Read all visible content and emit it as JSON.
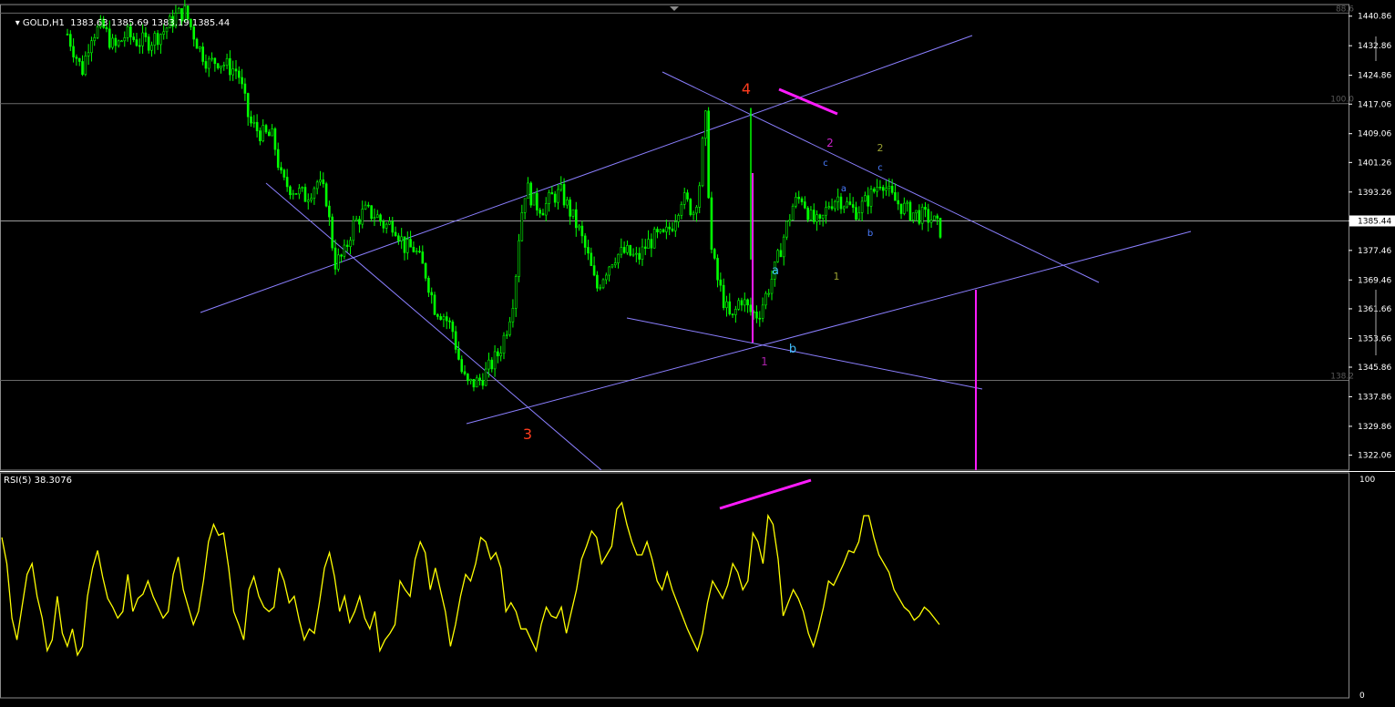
{
  "header": {
    "symbol_info": "GOLD,H1  1383.63 1385.69 1383.19 1385.44",
    "current_price": "1385.44"
  },
  "rsi_header": "RSI(5) 38.3076",
  "chart_data": [
    {
      "type": "candlestick",
      "symbol": "GOLD",
      "timeframe": "H1",
      "ohlc_last": {
        "open": 1383.63,
        "high": 1385.69,
        "low": 1383.19,
        "close": 1385.44
      },
      "ylim": [
        1318.0,
        1444.0
      ],
      "y_ticks": [
        "1440.86",
        "1432.86",
        "1424.86",
        "1417.06",
        "1409.06",
        "1401.26",
        "1393.26",
        "1385.46",
        "1377.46",
        "1369.46",
        "1361.66",
        "1353.66",
        "1345.86",
        "1337.86",
        "1329.86",
        "1322.06"
      ],
      "fib_levels": [
        {
          "label": "88.6",
          "price": 1441.7
        },
        {
          "label": "100.0",
          "price": 1417.2
        },
        {
          "label": "138.2",
          "price": 1342.3
        }
      ],
      "current_price_line": 1385.44,
      "close_path": [
        [
          0,
          1436
        ],
        [
          2,
          1432
        ],
        [
          5,
          1426
        ],
        [
          8,
          1436
        ],
        [
          12,
          1438
        ],
        [
          16,
          1432
        ],
        [
          20,
          1436
        ],
        [
          24,
          1434
        ],
        [
          28,
          1434
        ],
        [
          33,
          1437
        ],
        [
          37,
          1441
        ],
        [
          40,
          1442
        ],
        [
          42,
          1438
        ],
        [
          45,
          1432
        ],
        [
          48,
          1428
        ],
        [
          51,
          1429
        ],
        [
          55,
          1427
        ],
        [
          58,
          1426
        ],
        [
          62,
          1412
        ],
        [
          66,
          1409
        ],
        [
          70,
          1408
        ],
        [
          73,
          1396
        ],
        [
          77,
          1394
        ],
        [
          81,
          1392
        ],
        [
          85,
          1396
        ],
        [
          88,
          1392
        ],
        [
          90,
          1380
        ],
        [
          91,
          1374
        ],
        [
          94,
          1376
        ],
        [
          97,
          1384
        ],
        [
          101,
          1388
        ],
        [
          105,
          1387
        ],
        [
          108,
          1384
        ],
        [
          111,
          1385
        ],
        [
          115,
          1378
        ],
        [
          118,
          1378
        ],
        [
          122,
          1371
        ],
        [
          125,
          1362
        ],
        [
          128,
          1360
        ],
        [
          131,
          1356
        ],
        [
          134,
          1345
        ],
        [
          136,
          1341
        ],
        [
          140,
          1342
        ],
        [
          143,
          1345
        ],
        [
          147,
          1350
        ],
        [
          150,
          1358
        ],
        [
          152,
          1366
        ],
        [
          154,
          1385
        ],
        [
          156,
          1395
        ],
        [
          159,
          1390
        ],
        [
          162,
          1389
        ],
        [
          165,
          1392
        ],
        [
          168,
          1393
        ],
        [
          171,
          1388
        ],
        [
          174,
          1383
        ],
        [
          177,
          1376
        ],
        [
          180,
          1367
        ],
        [
          183,
          1372
        ],
        [
          186,
          1376
        ],
        [
          190,
          1377
        ],
        [
          194,
          1375
        ],
        [
          197,
          1379
        ],
        [
          200,
          1381
        ],
        [
          203,
          1381
        ],
        [
          206,
          1385
        ],
        [
          209,
          1392
        ],
        [
          211,
          1390
        ],
        [
          213,
          1388
        ],
        [
          215,
          1395
        ],
        [
          217,
          1415
        ],
        [
          219,
          1378
        ],
        [
          221,
          1370
        ],
        [
          224,
          1362
        ],
        [
          226,
          1358
        ],
        [
          229,
          1365
        ],
        [
          232,
          1361
        ],
        [
          235,
          1360
        ],
        [
          238,
          1366
        ],
        [
          241,
          1373
        ],
        [
          244,
          1382
        ],
        [
          247,
          1390
        ],
        [
          250,
          1392
        ],
        [
          253,
          1386
        ],
        [
          256,
          1384
        ],
        [
          259,
          1390
        ],
        [
          262,
          1392
        ],
        [
          265,
          1390
        ],
        [
          268,
          1388
        ],
        [
          271,
          1390
        ],
        [
          274,
          1393
        ],
        [
          277,
          1397
        ],
        [
          280,
          1392
        ],
        [
          283,
          1390
        ],
        [
          286,
          1388
        ],
        [
          290,
          1387
        ],
        [
          294,
          1386
        ],
        [
          297,
          1383
        ]
      ],
      "wave_labels": [
        {
          "text": "4",
          "color": "#ff3c1e"
        },
        {
          "text": "3",
          "color": "#ff3c1e"
        },
        {
          "text": "2",
          "color": "#cc22cc"
        },
        {
          "text": "2",
          "color": "#9aa032"
        },
        {
          "text": "1",
          "color": "#aa22aa"
        },
        {
          "text": "1",
          "color": "#9aa032"
        },
        {
          "text": "a",
          "color": "#40c0ff"
        },
        {
          "text": "b",
          "color": "#40c0ff"
        },
        {
          "text": "a",
          "color": "#4a7cff"
        },
        {
          "text": "b",
          "color": "#4a7cff"
        },
        {
          "text": "c",
          "color": "#4a7cff"
        },
        {
          "text": "c",
          "color": "#4a7cff"
        }
      ]
    },
    {
      "type": "line",
      "title": "RSI(5) 38.3076",
      "ylim": [
        0,
        100
      ],
      "y_ticks": [
        "100",
        "0"
      ],
      "last_value": 38.3076,
      "series": [
        {
          "color": "#ffff00",
          "values": [
            72,
            60,
            35,
            25,
            40,
            55,
            60,
            45,
            35,
            20,
            25,
            45,
            28,
            22,
            30,
            18,
            22,
            45,
            58,
            66,
            54,
            44,
            40,
            35,
            38,
            55,
            38,
            44,
            46,
            52,
            45,
            40,
            35,
            38,
            55,
            63,
            48,
            40,
            32,
            38,
            52,
            70,
            78,
            73,
            74,
            58,
            38,
            32,
            25,
            48,
            54,
            45,
            40,
            38,
            40,
            58,
            52,
            42,
            45,
            34,
            25,
            30,
            28,
            42,
            58,
            65,
            54,
            38,
            45,
            33,
            38,
            45,
            35,
            30,
            38,
            20,
            25,
            28,
            32,
            52,
            48,
            45,
            62,
            70,
            65,
            48,
            58,
            48,
            38,
            22,
            32,
            45,
            55,
            52,
            60,
            72,
            70,
            62,
            65,
            58,
            38,
            42,
            38,
            30,
            30,
            25,
            20,
            32,
            40,
            36,
            35,
            40,
            28,
            38,
            48,
            62,
            68,
            75,
            72,
            60,
            64,
            68,
            85,
            88,
            78,
            70,
            64,
            64,
            70,
            62,
            52,
            48,
            56,
            48,
            42,
            36,
            30,
            25,
            20,
            28,
            42,
            52,
            48,
            44,
            50,
            60,
            56,
            48,
            52,
            74,
            70,
            60,
            82,
            78,
            62,
            36,
            42,
            48,
            44,
            38,
            28,
            22,
            30,
            40,
            52,
            50,
            55,
            60,
            66,
            65,
            70,
            82,
            82,
            72,
            64,
            60,
            56,
            48,
            44,
            40,
            38,
            34,
            36,
            40,
            38,
            35,
            32
          ],
          "note": "hourly RSI(5) oscillation"
        }
      ]
    }
  ],
  "colors": {
    "background": "#000000",
    "grid": "#6a6a6a",
    "candle": "#00ff00",
    "trendline": "#8b7fff",
    "fib_text": "#5a5a5a",
    "magenta": "#ff1bff",
    "rsi": "#ffff00",
    "axis_text": "#ffffff"
  }
}
